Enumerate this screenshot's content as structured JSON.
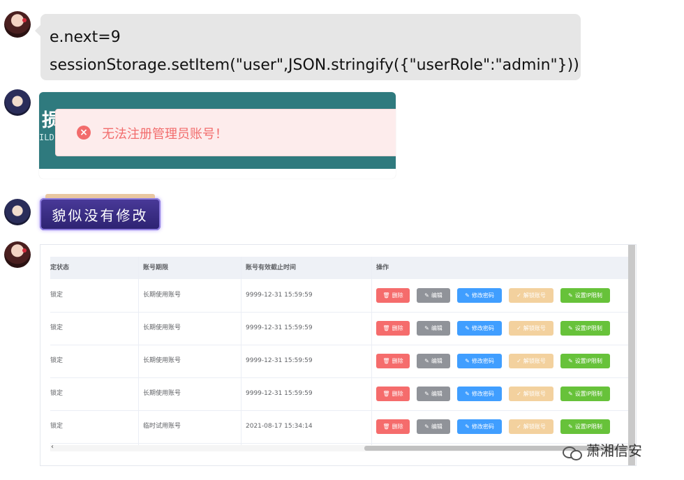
{
  "messages": {
    "code_lines": [
      "e.next=9",
      "sessionStorage.setItem(\"user\",JSON.stringify({\"userRole\":\"admin\"}))"
    ],
    "screenshot_bg_char": "损",
    "screenshot_bg_text": "ILD",
    "alert_text": "无法注册管理员账号！",
    "sticker_text": "貌似没有修改"
  },
  "table": {
    "headers": [
      "定状态",
      "账号期限",
      "账号有效截止时间",
      "操作"
    ],
    "rows": [
      {
        "status": "锁定",
        "term": "长期使用账号",
        "expire": "9999-12-31 15:59:59"
      },
      {
        "status": "锁定",
        "term": "长期使用账号",
        "expire": "9999-12-31 15:59:59"
      },
      {
        "status": "锁定",
        "term": "长期使用账号",
        "expire": "9999-12-31 15:59:59"
      },
      {
        "status": "锁定",
        "term": "长期使用账号",
        "expire": "9999-12-31 15:59:59"
      },
      {
        "status": "锁定",
        "term": "临时试用账号",
        "expire": "2021-08-17 15:34:14"
      }
    ],
    "buttons": {
      "delete": "删除",
      "edit": "编辑",
      "change_password": "修改密码",
      "unlock": "解锁账号",
      "ip_limit": "设置IP限制"
    },
    "scroll_left": "‹"
  },
  "watermark": "萧湘信安",
  "colors": {
    "danger": "#f56c6c",
    "info": "#909399",
    "primary": "#409eff",
    "warning_light": "#f3d19e",
    "success": "#67c23a",
    "teal": "#2f7a7e"
  }
}
